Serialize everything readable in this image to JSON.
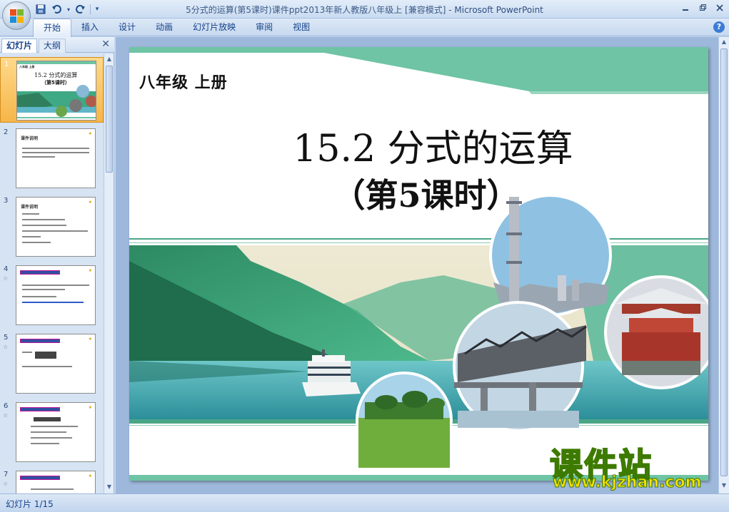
{
  "window": {
    "title": "5分式的运算(第5课时)课件ppt2013年新人教版八年级上 [兼容模式]",
    "app_name": "Microsoft PowerPoint",
    "title_separator": " - "
  },
  "ribbon": {
    "tabs": [
      "开始",
      "插入",
      "设计",
      "动画",
      "幻灯片放映",
      "审阅",
      "视图"
    ],
    "active_tab": "开始",
    "help_label": "?"
  },
  "left_pane": {
    "tabs": {
      "slides": "幻灯片",
      "outline": "大纲"
    },
    "close_label": "✕",
    "thumbnails": [
      {
        "number": "1",
        "selected": true,
        "title": "15.2  分式的运算",
        "subtitle": "（第5课时）",
        "grade": "八年级  上册"
      },
      {
        "number": "2",
        "selected": false,
        "title": "课件说明"
      },
      {
        "number": "3",
        "selected": false,
        "title": "课件说明"
      },
      {
        "number": "4",
        "selected": false,
        "title": ""
      },
      {
        "number": "5",
        "selected": false,
        "title": ""
      },
      {
        "number": "6",
        "selected": false,
        "title": ""
      },
      {
        "number": "7",
        "selected": false,
        "title": ""
      }
    ]
  },
  "slide": {
    "grade": "八年级    上册",
    "title": "15.2  分式的运算",
    "subtitle": "（第5课时）"
  },
  "watermark": {
    "title": "课件站",
    "url": "www.kjzhan.com"
  },
  "status_bar": {
    "slide_info": "幻灯片 1/15"
  },
  "colors": {
    "teal": "#6ec4a4",
    "ribbon_blue": "#15428b",
    "selected_thumb": "#f6b64a"
  }
}
